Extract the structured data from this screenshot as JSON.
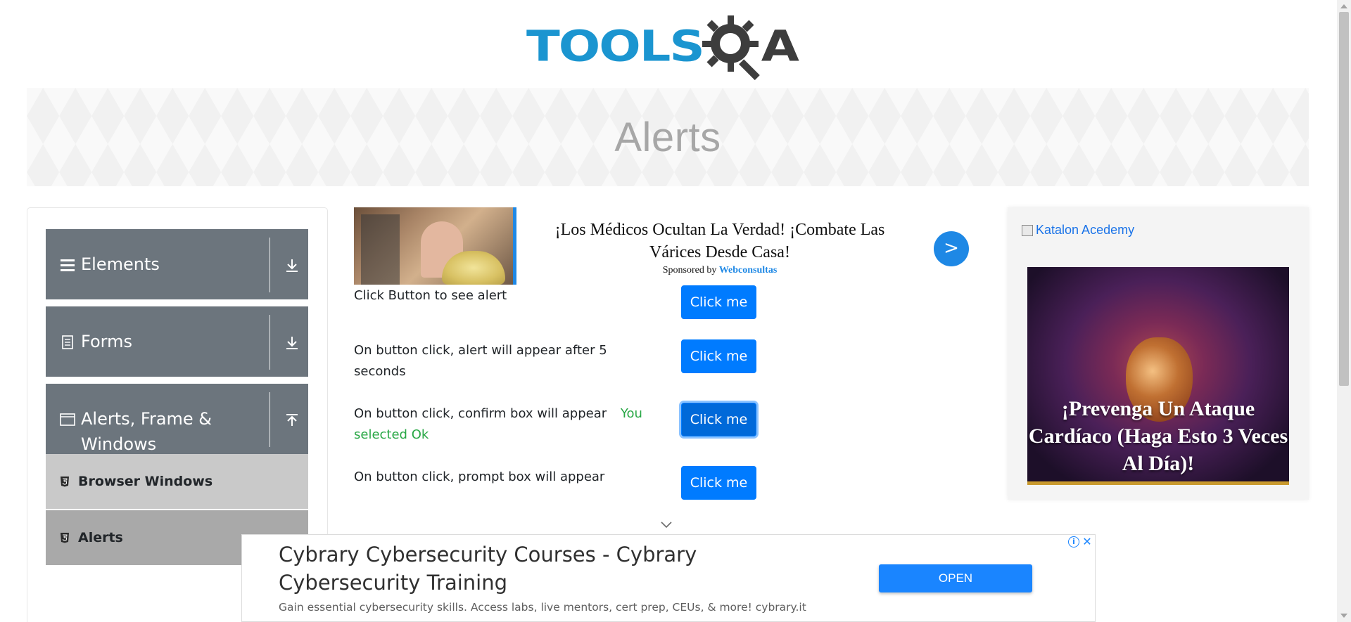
{
  "header": {
    "logo_text": "TOOLS",
    "logo_text_suffix": "A"
  },
  "banner": {
    "title": "Alerts"
  },
  "sidebar": {
    "groups": [
      {
        "label": "Elements",
        "icon": "hamburger-icon",
        "toggle_icon": "download-arrow-icon"
      },
      {
        "label": "Forms",
        "icon": "document-icon",
        "toggle_icon": "download-arrow-icon"
      },
      {
        "label": "Alerts, Frame & Windows",
        "label_line1": "Alerts, Frame &",
        "label_line2": "Windows",
        "icon": "window-icon",
        "toggle_icon": "upload-arrow-icon"
      }
    ],
    "items": [
      {
        "label": "Browser Windows",
        "icon": "html5-icon"
      },
      {
        "label": "Alerts",
        "icon": "html5-icon",
        "active": true
      }
    ]
  },
  "ad_top": {
    "headline": "¡Los Médicos Ocultan La Verdad! ¡Combate Las Várices Desde Casa!",
    "sponsor_prefix": "Sponsored by",
    "sponsor_name": "Webconsultas",
    "arrow": ">"
  },
  "rows": [
    {
      "text": "Click Button to see alert",
      "button": "Click me"
    },
    {
      "text_line1": "On button click, alert will appear after 5",
      "text_line2": "seconds",
      "button": "Click me"
    },
    {
      "text": "On button click, confirm box will appear",
      "result_line1": "You",
      "result_line2": "selected Ok",
      "button": "Click me"
    },
    {
      "text": "On button click, prompt box will appear",
      "button": "Click me"
    }
  ],
  "ad_right": {
    "alt_text": "Katalon Acedemy",
    "caption": "¡Prevenga Un Ataque Cardíaco (Haga Esto 3 Veces Al Día)!"
  },
  "ad_bottom": {
    "title": "Cybrary Cybersecurity Courses - Cybrary Cybersecurity Training",
    "description": "Gain essential cybersecurity skills. Access labs, live mentors, cert prep, CEUs, & more! cybrary.it",
    "cta": "OPEN",
    "info": "i",
    "close": "✕"
  },
  "colors": {
    "brand_blue": "#1b95d0",
    "button_blue": "#007bff",
    "sidebar_gray": "#6c757d",
    "success_green": "#28a745"
  }
}
